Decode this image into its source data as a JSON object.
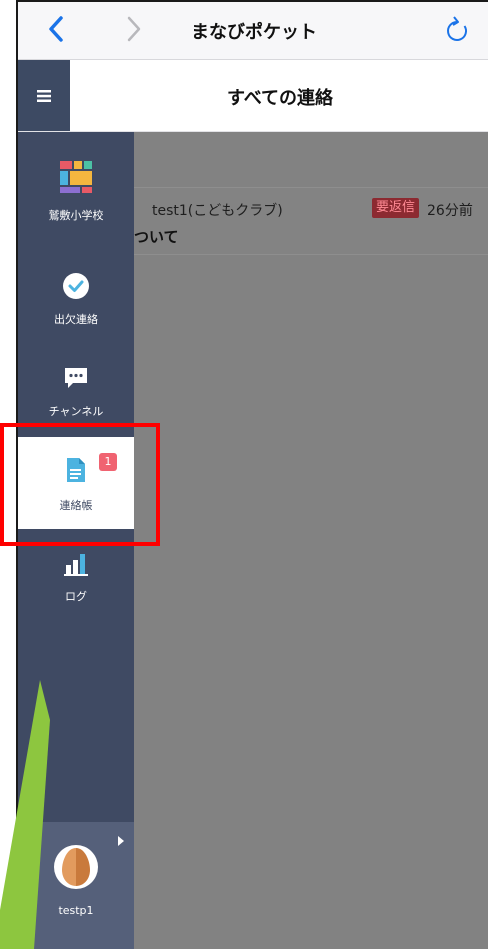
{
  "browser": {
    "title": "まなびポケット",
    "back_icon": "chevron-left-icon",
    "forward_icon": "chevron-right-icon",
    "reload_icon": "reload-icon"
  },
  "header": {
    "title": "すべての連絡",
    "menu_icon": "hamburger-menu-icon"
  },
  "sidebar": {
    "items": [
      {
        "label": "鷲敷小学校",
        "icon": "school-grid-icon"
      },
      {
        "label": "出欠連絡",
        "icon": "check-circle-icon"
      },
      {
        "label": "チャンネル",
        "icon": "chat-bubble-icon"
      },
      {
        "label": "連絡帳",
        "icon": "document-icon",
        "badge": "1",
        "active": true
      },
      {
        "label": "ログ",
        "icon": "bar-chart-icon"
      }
    ],
    "user": {
      "name": "testp1",
      "avatar": "egg-avatar"
    }
  },
  "messages": [
    {
      "sender": "test1(こどもクラブ)",
      "badge": "要返信",
      "time": "26分前",
      "subject": "ついて"
    }
  ],
  "colors": {
    "sidebar": "#3f4a63",
    "accent_blue": "#1a73e8",
    "badge_red": "#f06371",
    "highlight": "#ff0000",
    "overlay": "#828282"
  }
}
